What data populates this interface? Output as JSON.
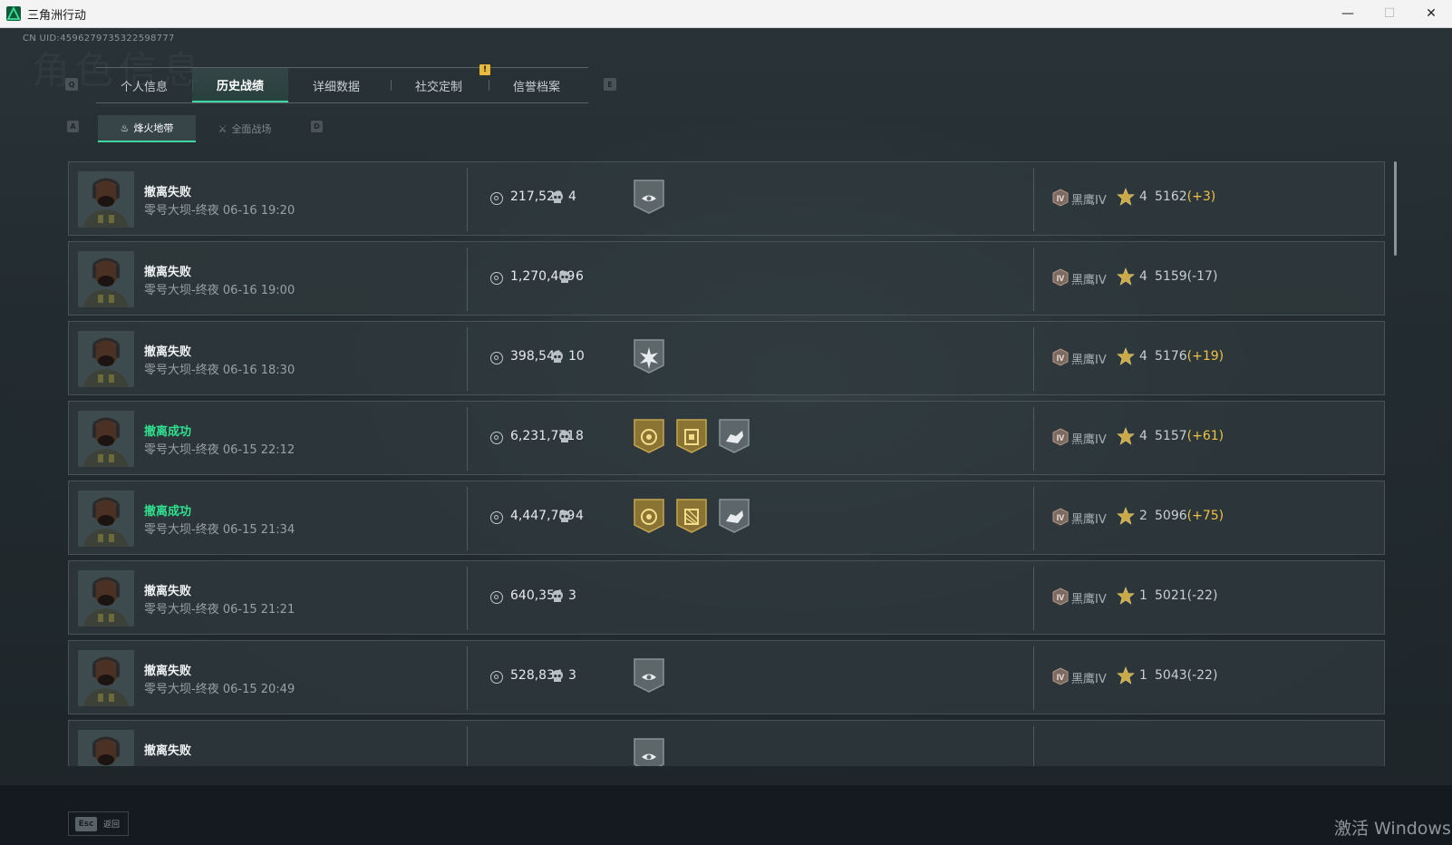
{
  "window": {
    "title": "三角洲行动",
    "minimize": "—",
    "maximize": "☐",
    "close": "✕"
  },
  "uid": "CN UID:4596279735322598777",
  "watermark": "角色信息",
  "tabs": {
    "left_key": "Q",
    "right_key": "E",
    "alert": "!",
    "items": [
      {
        "label": "个人信息"
      },
      {
        "label": "历史战绩"
      },
      {
        "label": "详细数据"
      },
      {
        "label": "社交定制"
      },
      {
        "label": "信誉档案"
      }
    ],
    "active_index": 1
  },
  "subtabs": {
    "left_key": "A",
    "right_key": "D",
    "items": [
      {
        "label": "烽火地带",
        "icon": "beacon-icon"
      },
      {
        "label": "全面战场",
        "icon": "battlefield-icon"
      }
    ],
    "active_index": 0
  },
  "rank_name": "黑鹰IV",
  "matches": [
    {
      "result": "撤离失败",
      "success": false,
      "map": "零号大坝-终夜",
      "time": "06-16 19:20",
      "value": "217,523",
      "kills": "4",
      "badges": [
        "gray-eye-badge"
      ],
      "stars": "4",
      "score": "5162",
      "delta": "(+3)",
      "delta_positive": true
    },
    {
      "result": "撤离失败",
      "success": false,
      "map": "零号大坝-终夜",
      "time": "06-16 19:00",
      "value": "1,270,489",
      "kills": "6",
      "badges": [],
      "stars": "4",
      "score": "5159",
      "delta": "(-17)",
      "delta_positive": false
    },
    {
      "result": "撤离失败",
      "success": false,
      "map": "零号大坝-终夜",
      "time": "06-16 18:30",
      "value": "398,541",
      "kills": "10",
      "badges": [
        "gray-burst-badge"
      ],
      "stars": "4",
      "score": "5176",
      "delta": "(+19)",
      "delta_positive": true
    },
    {
      "result": "撤离成功",
      "success": true,
      "map": "零号大坝-终夜",
      "time": "06-15 22:12",
      "value": "6,231,771",
      "kills": "8",
      "badges": [
        "gold-coin-badge",
        "gold-crate-badge",
        "gray-hand-badge"
      ],
      "stars": "4",
      "score": "5157",
      "delta": "(+61)",
      "delta_positive": true
    },
    {
      "result": "撤离成功",
      "success": true,
      "map": "零号大坝-终夜",
      "time": "06-15 21:34",
      "value": "4,447,789",
      "kills": "4",
      "badges": [
        "gold-coin-badge",
        "gold-grid-badge",
        "gray-hand-badge"
      ],
      "stars": "2",
      "score": "5096",
      "delta": "(+75)",
      "delta_positive": true
    },
    {
      "result": "撤离失败",
      "success": false,
      "map": "零号大坝-终夜",
      "time": "06-15 21:21",
      "value": "640,354",
      "kills": "3",
      "badges": [],
      "stars": "1",
      "score": "5021",
      "delta": "(-22)",
      "delta_positive": false
    },
    {
      "result": "撤离失败",
      "success": false,
      "map": "零号大坝-终夜",
      "time": "06-15 20:49",
      "value": "528,834",
      "kills": "3",
      "badges": [
        "gray-eye-badge"
      ],
      "stars": "1",
      "score": "5043",
      "delta": "(-22)",
      "delta_positive": false
    },
    {
      "result": "撤离失败",
      "success": false,
      "map": "",
      "time": "",
      "value": "",
      "kills": "",
      "badges": [
        "gray-eye-badge"
      ],
      "stars": "",
      "score": "",
      "delta": "",
      "delta_positive": false
    }
  ],
  "footer": {
    "esc_key": "Esc",
    "esc_label": "返回",
    "activation_text": "激活 Windows"
  }
}
